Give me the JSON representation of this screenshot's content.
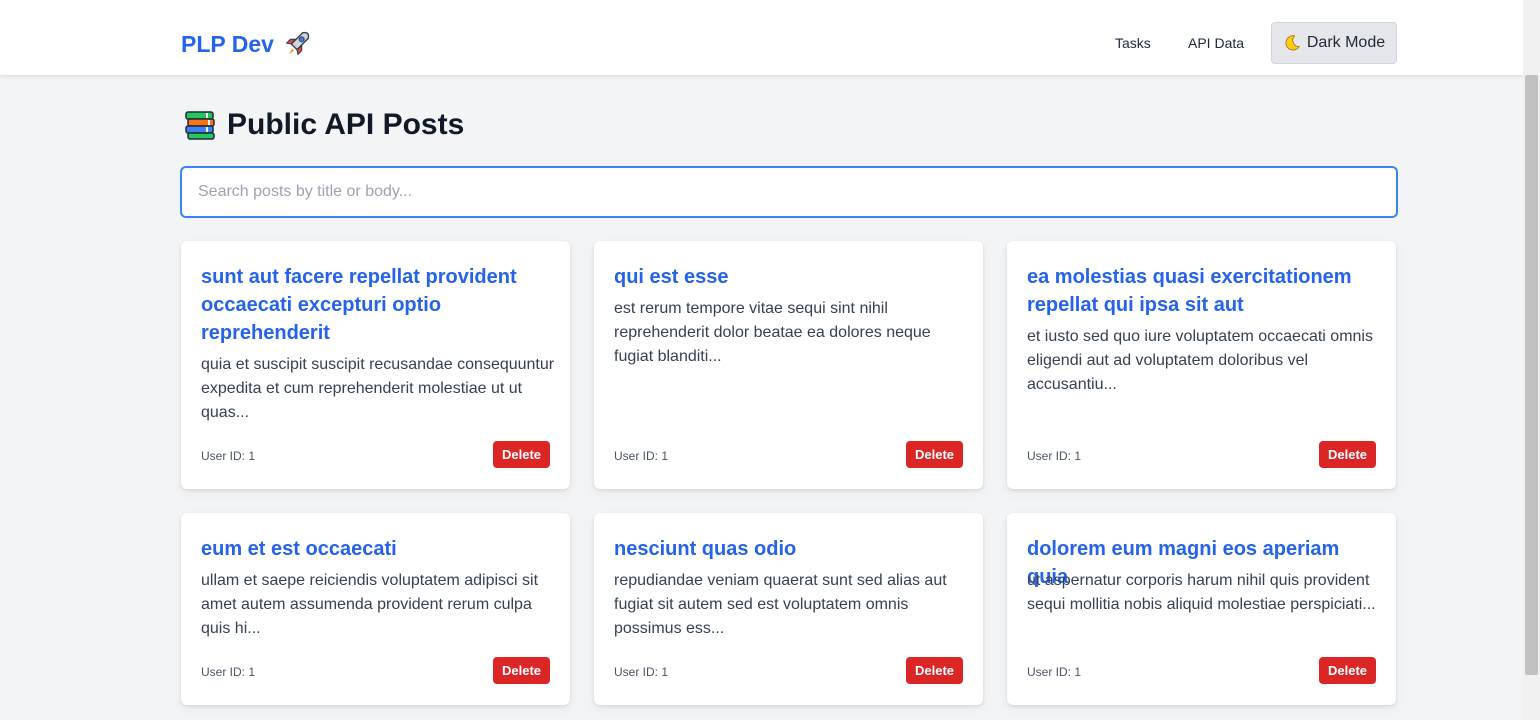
{
  "navbar": {
    "brand": "PLP Dev",
    "brand_icon": "rocket-icon",
    "links": [
      "Tasks",
      "API Data"
    ],
    "dark_mode_label": "Dark Mode",
    "dark_mode_icon": "moon-icon"
  },
  "page": {
    "title": "Public API Posts",
    "title_icon": "books-icon"
  },
  "search": {
    "placeholder": "Search posts by title or body...",
    "value": ""
  },
  "posts": [
    {
      "title": "sunt aut facere repellat provident occaecati excepturi optio reprehenderit",
      "body": "quia et suscipit suscipit recusandae consequuntur expedita et cum reprehenderit molestiae ut ut quas...",
      "user": "User ID: 1",
      "delete_label": "Delete"
    },
    {
      "title": "qui est esse",
      "body": "est rerum tempore vitae sequi sint nihil reprehenderit dolor beatae ea dolores neque fugiat blanditi...",
      "user": "User ID: 1",
      "delete_label": "Delete"
    },
    {
      "title": "ea molestias quasi exercitationem repellat qui ipsa sit aut",
      "body": "et iusto sed quo iure voluptatem occaecati omnis eligendi aut ad voluptatem doloribus vel accusantiu...",
      "user": "User ID: 1",
      "delete_label": "Delete"
    },
    {
      "title": "eum et est occaecati",
      "body": "ullam et saepe reiciendis voluptatem adipisci sit amet autem assumenda provident rerum culpa quis hi...",
      "user": "User ID: 1",
      "delete_label": "Delete"
    },
    {
      "title": "nesciunt quas odio",
      "body": "repudiandae veniam quaerat sunt sed alias aut fugiat sit autem sed est voluptatem omnis possimus ess...",
      "user": "User ID: 1",
      "delete_label": "Delete"
    },
    {
      "title": "dolorem eum magni eos aperiam quia",
      "body": "ut aspernatur corporis harum nihil quis provident sequi mollitia nobis aliquid molestiae perspiciati...",
      "user": "User ID: 1",
      "delete_label": "Delete"
    }
  ],
  "colors": {
    "brand": "#2563eb",
    "delete": "#dc2626",
    "search_border": "#3b82f6",
    "background": "#f3f4f6"
  }
}
